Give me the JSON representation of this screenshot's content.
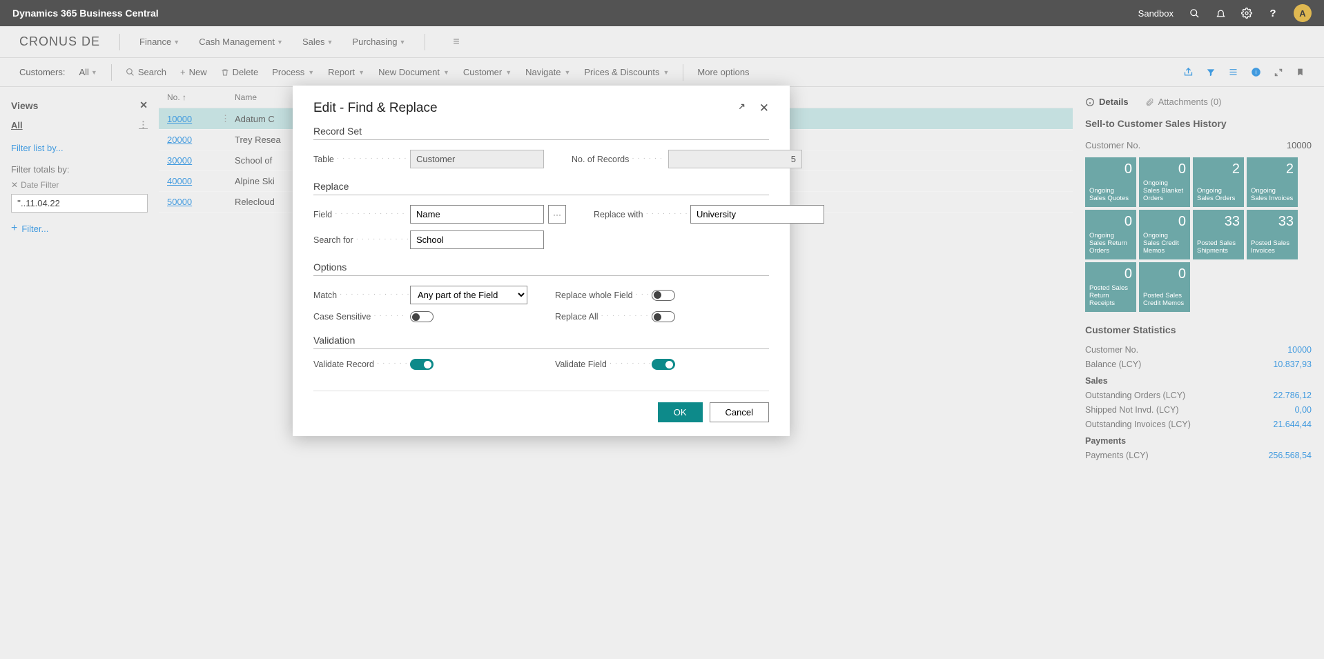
{
  "topbar": {
    "title": "Dynamics 365 Business Central",
    "env": "Sandbox",
    "avatar": "A"
  },
  "menubar": {
    "company": "CRONUS DE",
    "items": [
      "Finance",
      "Cash Management",
      "Sales",
      "Purchasing"
    ]
  },
  "actionbar": {
    "page_label": "Customers:",
    "view": "All",
    "search": "Search",
    "new": "New",
    "delete": "Delete",
    "items": [
      "Process",
      "Report",
      "New Document",
      "Customer",
      "Navigate",
      "Prices & Discounts"
    ],
    "more": "More options"
  },
  "views": {
    "title": "Views",
    "all": "All",
    "filter_list": "Filter list by...",
    "filter_totals": "Filter totals by:",
    "chip": "Date Filter",
    "date_value": "''..11.04.22",
    "add": "Filter..."
  },
  "grid": {
    "headers": {
      "no": "No. ↑",
      "name": "Name"
    },
    "rows": [
      {
        "no": "10000",
        "name": "Adatum C",
        "sel": true
      },
      {
        "no": "20000",
        "name": "Trey Resea"
      },
      {
        "no": "30000",
        "name": "School of"
      },
      {
        "no": "40000",
        "name": "Alpine Ski"
      },
      {
        "no": "50000",
        "name": "Relecloud"
      }
    ]
  },
  "factbox": {
    "tabs": {
      "details": "Details",
      "attachments": "Attachments (0)"
    },
    "hist_title": "Sell-to Customer Sales History",
    "cust_no_label": "Customer No.",
    "cust_no": "10000",
    "tiles": [
      {
        "n": "0",
        "l": "Ongoing Sales Quotes"
      },
      {
        "n": "0",
        "l": "Ongoing Sales Blanket Orders"
      },
      {
        "n": "2",
        "l": "Ongoing Sales Orders"
      },
      {
        "n": "2",
        "l": "Ongoing Sales Invoices"
      },
      {
        "n": "0",
        "l": "Ongoing Sales Return Orders"
      },
      {
        "n": "0",
        "l": "Ongoing Sales Credit Memos"
      },
      {
        "n": "33",
        "l": "Posted Sales Shipments"
      },
      {
        "n": "33",
        "l": "Posted Sales Invoices"
      },
      {
        "n": "0",
        "l": "Posted Sales Return Receipts"
      },
      {
        "n": "0",
        "l": "Posted Sales Credit Memos"
      }
    ],
    "stats_title": "Customer Statistics",
    "stats": [
      {
        "l": "Customer No.",
        "v": "10000"
      },
      {
        "l": "Balance (LCY)",
        "v": "10.837,93"
      }
    ],
    "sales_hd": "Sales",
    "sales": [
      {
        "l": "Outstanding Orders (LCY)",
        "v": "22.786,12"
      },
      {
        "l": "Shipped Not Invd. (LCY)",
        "v": "0,00"
      },
      {
        "l": "Outstanding Invoices (LCY)",
        "v": "21.644,44"
      }
    ],
    "pay_hd": "Payments",
    "pay": [
      {
        "l": "Payments (LCY)",
        "v": "256.568,54"
      }
    ]
  },
  "modal": {
    "title": "Edit - Find & Replace",
    "s_recordset": "Record Set",
    "table_l": "Table",
    "table_v": "Customer",
    "norec_l": "No. of Records",
    "norec_v": "5",
    "s_replace": "Replace",
    "field_l": "Field",
    "field_v": "Name",
    "search_l": "Search for",
    "search_v": "School",
    "replace_l": "Replace with",
    "replace_v": "University",
    "s_options": "Options",
    "match_l": "Match",
    "match_v": "Any part of the Field",
    "casesens_l": "Case Sensitive",
    "repwhole_l": "Replace whole Field",
    "repall_l": "Replace All",
    "s_validation": "Validation",
    "valrec_l": "Validate Record",
    "valfld_l": "Validate Field",
    "ok": "OK",
    "cancel": "Cancel"
  }
}
